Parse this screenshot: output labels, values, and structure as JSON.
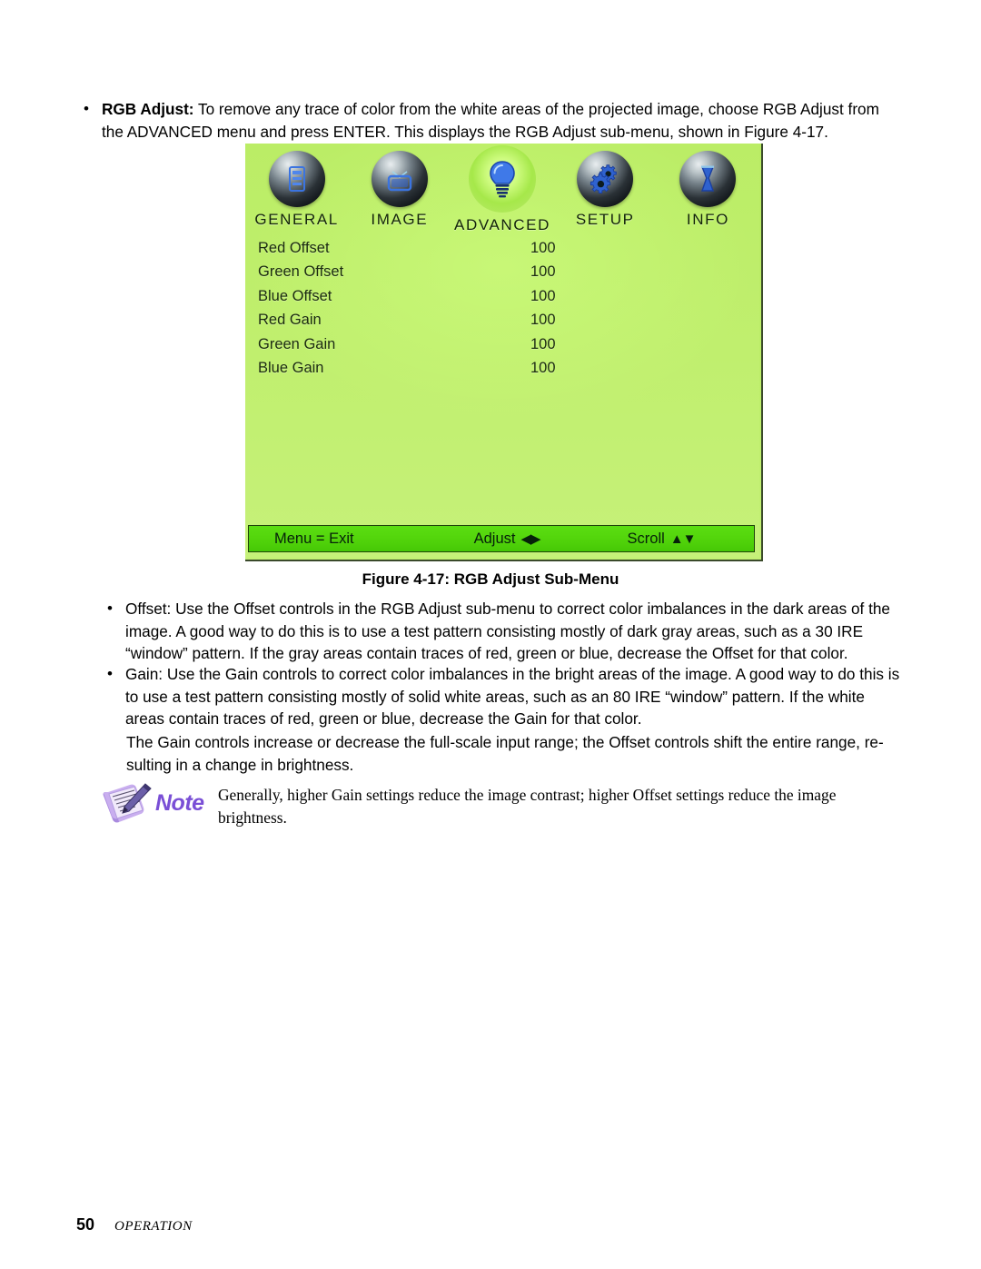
{
  "intro": {
    "bullet": "•",
    "lead": "RGB Adjust:",
    "body": " To remove any trace of color from the white areas of the projected image, choose RGB Adjust from the ADVANCED menu and press ENTER. This displays the RGB Adjust sub-menu, shown in Figure 4-17."
  },
  "osd": {
    "tabs": [
      {
        "label": "GENERAL",
        "icon": "document-icon",
        "selected": false
      },
      {
        "label": "IMAGE",
        "icon": "television-icon",
        "selected": false
      },
      {
        "label": "ADVANCED",
        "icon": "lightbulb-icon",
        "selected": true
      },
      {
        "label": "SETUP",
        "icon": "gears-icon",
        "selected": false
      },
      {
        "label": "INFO",
        "icon": "hourglass-icon",
        "selected": false
      }
    ],
    "rows": [
      {
        "label": "Red Offset",
        "value": "100"
      },
      {
        "label": "Green Offset",
        "value": "100"
      },
      {
        "label": "Blue Offset",
        "value": "100"
      },
      {
        "label": "Red Gain",
        "value": "100"
      },
      {
        "label": "Green Gain",
        "value": "100"
      },
      {
        "label": "Blue Gain",
        "value": "100"
      }
    ],
    "footer": {
      "exit": "Menu = Exit",
      "adjust_label": "Adjust",
      "adjust_arrows": "◀▶",
      "scroll_label": "Scroll",
      "scroll_arrows": "▲▼"
    },
    "colors": {
      "background": "#bdee69",
      "footer_bar": "#54d60c",
      "selection_glow": "#cdfb7e",
      "icon_blue": "#2a5fd6"
    }
  },
  "figure_caption": "Figure 4-17: RGB Adjust Sub-Menu",
  "offset_bullet": {
    "bullet": "•",
    "text": "Offset: Use the Offset controls in the RGB Adjust sub-menu to correct color imbalances in the dark areas of the image. A good way to do this is to use a test pattern consisting mostly of dark gray areas, such as a 30 IRE “window” pattern. If the gray areas contain traces of red, green or blue, decrease the Offset for that color."
  },
  "gain_bullet": {
    "bullet": "•",
    "text": "Gain: Use the Gain controls to correct color imbalances in the bright areas of the image. A good way to do this is to use a test pattern consisting mostly of solid white areas, such as an 80 IRE “window” pattern. If the white areas contain traces of red, green or blue, decrease the Gain for that color."
  },
  "range_paragraph": "The Gain controls increase or decrease the full-scale input range; the Offset controls shift the entire range, re-sulting in a change in brightness.",
  "note": {
    "icon": "note-pad-pencil-icon",
    "word": "Note",
    "color": "#7a4fd6",
    "text": "Generally, higher Gain settings reduce the image contrast; higher Offset settings reduce the image brightness."
  },
  "page_footer": {
    "number": "50",
    "section": "OPERATION"
  }
}
